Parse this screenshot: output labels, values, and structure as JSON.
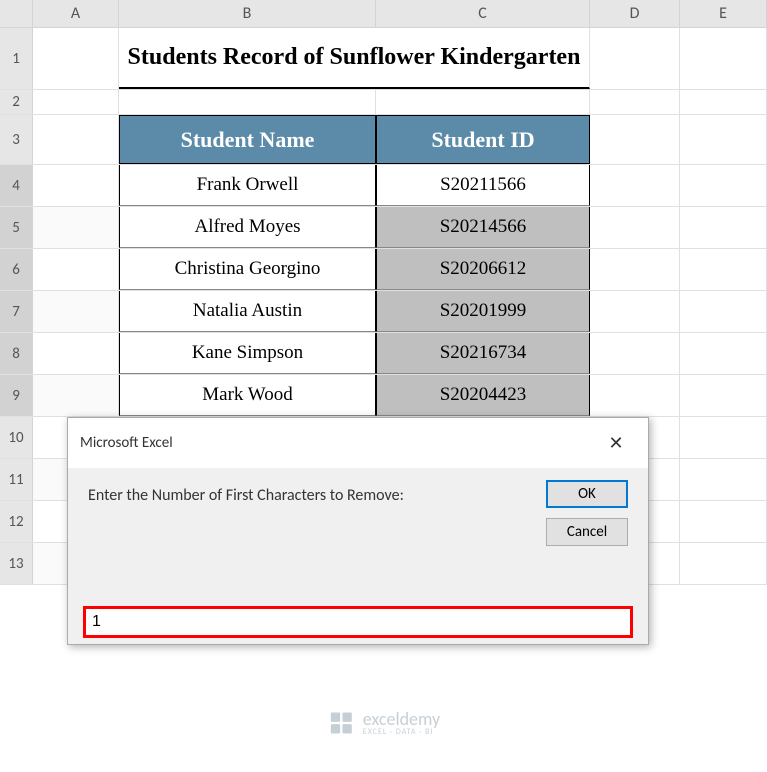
{
  "columns": [
    "A",
    "B",
    "C",
    "D",
    "E"
  ],
  "rows": [
    "1",
    "2",
    "3",
    "4",
    "5",
    "6",
    "7",
    "8",
    "9",
    "10",
    "11",
    "12",
    "13"
  ],
  "title": "Students Record of Sunflower Kindergarten",
  "table": {
    "headers": {
      "name": "Student Name",
      "id": "Student ID"
    },
    "data": [
      {
        "name": "Frank Orwell",
        "id": "S20211566"
      },
      {
        "name": "Alfred Moyes",
        "id": "S20214566"
      },
      {
        "name": "Christina Georgino",
        "id": "S20206612"
      },
      {
        "name": "Natalia Austin",
        "id": "S20201999"
      },
      {
        "name": "Kane Simpson",
        "id": "S20216734"
      },
      {
        "name": "Mark Wood",
        "id": "S20204423"
      }
    ]
  },
  "dialog": {
    "title": "Microsoft Excel",
    "prompt": "Enter the Number of First Characters to Remove:",
    "ok": "OK",
    "cancel": "Cancel",
    "value": "1",
    "close": "✕"
  },
  "watermark": {
    "brand": "exceldemy",
    "tagline": "EXCEL · DATA · BI"
  }
}
